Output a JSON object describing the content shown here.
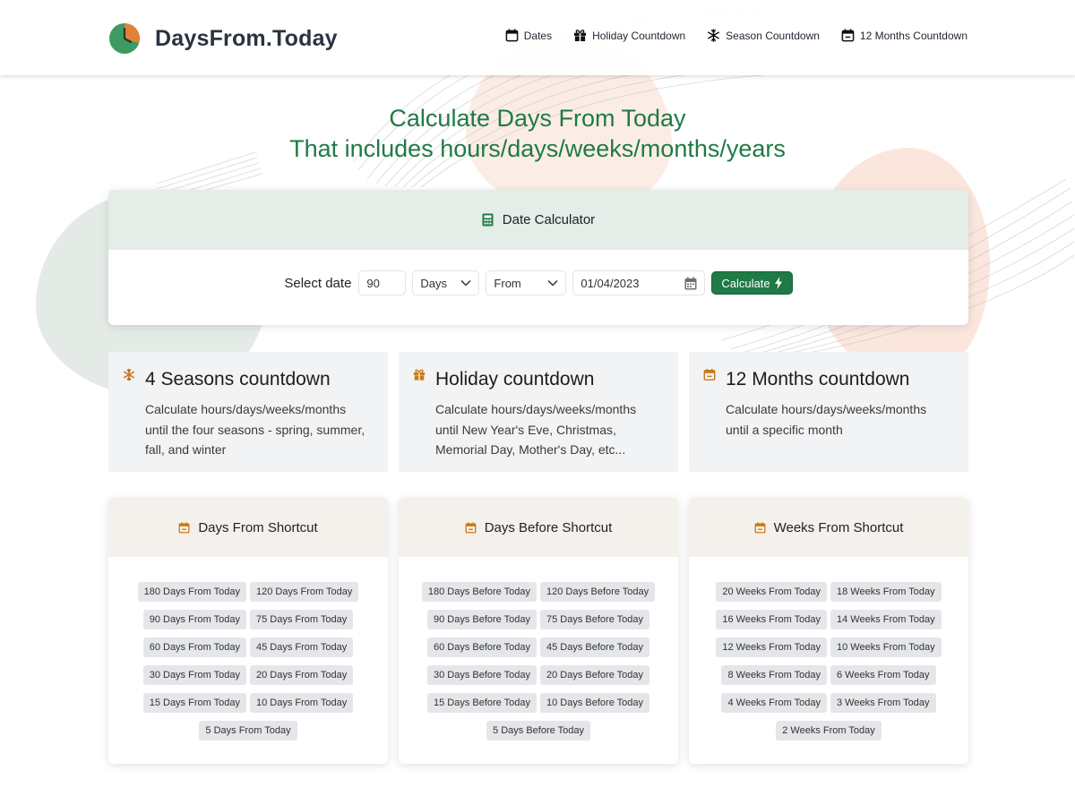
{
  "brand": {
    "name": "DaysFrom.Today"
  },
  "nav": [
    {
      "label": "Dates",
      "icon": "calendar-icon"
    },
    {
      "label": "Holiday Countdown",
      "icon": "gift-icon"
    },
    {
      "label": "Season Countdown",
      "icon": "snowflake-icon"
    },
    {
      "label": "12 Months Countdown",
      "icon": "calendar-minus-icon"
    }
  ],
  "hero": {
    "line1": "Calculate Days From Today",
    "line2": "That includes hours/days/weeks/months/years"
  },
  "calculator": {
    "title": "Date Calculator",
    "label": "Select date",
    "amount": "90",
    "unit": "Days",
    "direction": "From",
    "date": "01/04/2023",
    "button": "Calculate"
  },
  "features": [
    {
      "title": "4 Seasons countdown",
      "text": "Calculate hours/days/weeks/months until the four seasons - spring, summer, fall, and winter",
      "icon": "snowflake-icon"
    },
    {
      "title": "Holiday countdown",
      "text": "Calculate hours/days/weeks/months until New Year's Eve, Christmas, Memorial Day, Mother's Day, etc...",
      "icon": "gift-icon"
    },
    {
      "title": "12 Months countdown",
      "text": "Calculate hours/days/weeks/months until a specific month",
      "icon": "calendar-minus-icon"
    }
  ],
  "shortcuts": [
    {
      "title": "Days From Shortcut",
      "items": [
        "180 Days From Today",
        "120 Days From Today",
        "90 Days From Today",
        "75 Days From Today",
        "60 Days From Today",
        "45 Days From Today",
        "30 Days From Today",
        "20 Days From Today",
        "15 Days From Today",
        "10 Days From Today",
        "5 Days From Today"
      ]
    },
    {
      "title": "Days Before Shortcut",
      "items": [
        "180 Days Before Today",
        "120 Days Before Today",
        "90 Days Before Today",
        "75 Days Before Today",
        "60 Days Before Today",
        "45 Days Before Today",
        "30 Days Before Today",
        "20 Days Before Today",
        "15 Days Before Today",
        "10 Days Before Today",
        "5 Days Before Today"
      ]
    },
    {
      "title": "Weeks From Shortcut",
      "items": [
        "20 Weeks From Today",
        "18 Weeks From Today",
        "16 Weeks From Today",
        "14 Weeks From Today",
        "12 Weeks From Today",
        "10 Weeks From Today",
        "8 Weeks From Today",
        "6 Weeks From Today",
        "4 Weeks From Today",
        "3 Weeks From Today",
        "2 Weeks From Today"
      ]
    }
  ],
  "colors": {
    "primary_green": "#1f7a46",
    "accent_orange": "#c77a1a",
    "logo_green": "#3d9a62",
    "logo_orange": "#e0813a"
  }
}
